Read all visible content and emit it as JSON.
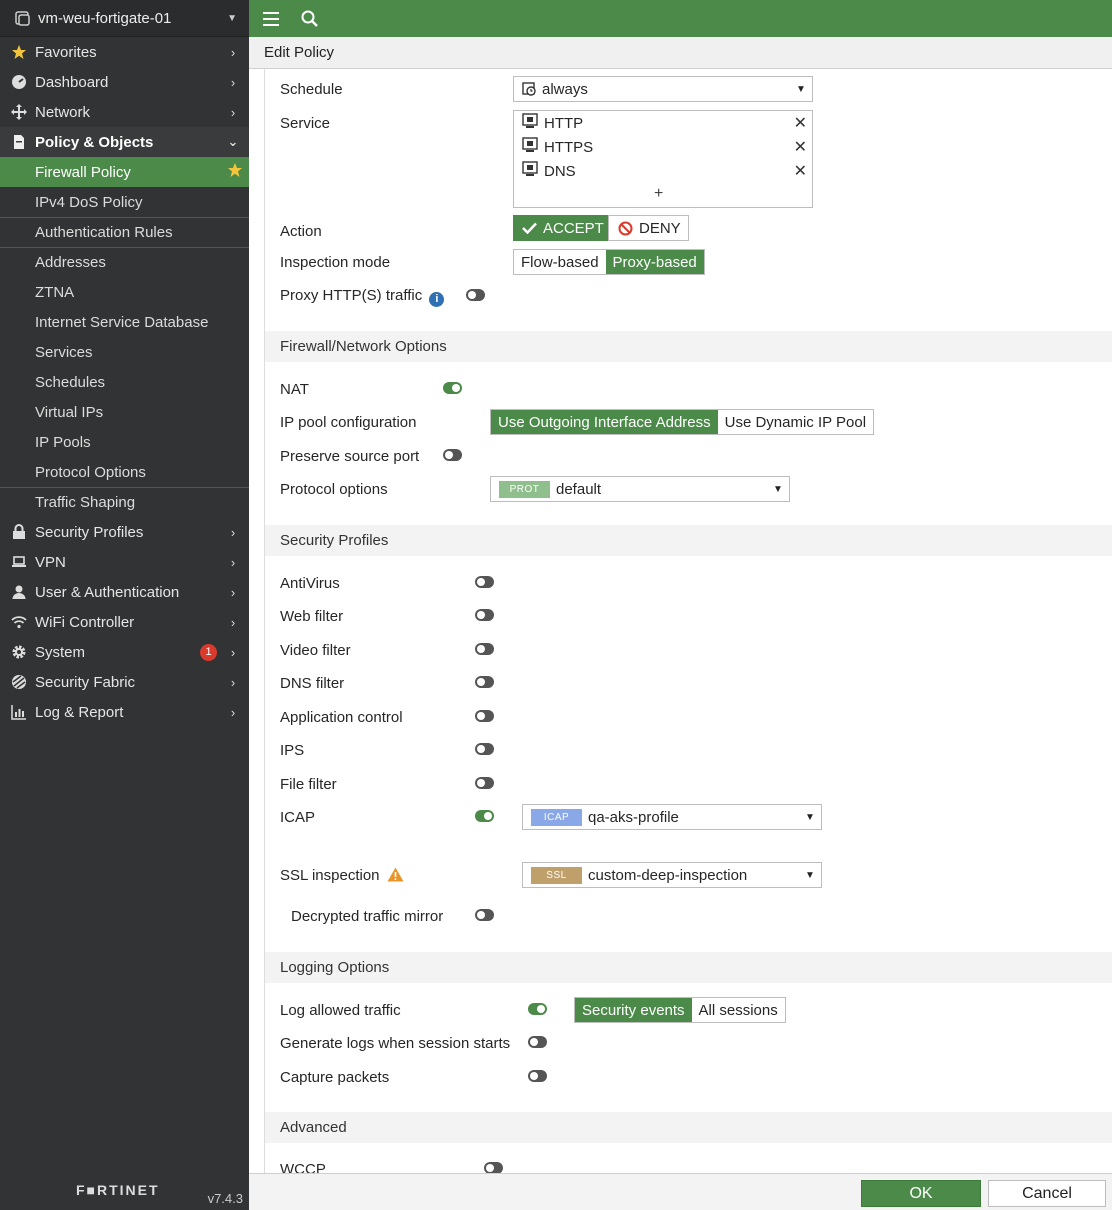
{
  "sidebar": {
    "device_name": "vm-weu-fortigate-01",
    "items": [
      {
        "label": "Favorites",
        "icon": "star-icon"
      },
      {
        "label": "Dashboard",
        "icon": "dashboard-icon"
      },
      {
        "label": "Network",
        "icon": "network-icon"
      },
      {
        "label": "Policy & Objects",
        "icon": "policy-icon"
      }
    ],
    "sub_items": [
      {
        "label": "Firewall Policy"
      },
      {
        "label": "IPv4 DoS Policy"
      },
      {
        "label": "Authentication Rules"
      },
      {
        "label": "Addresses"
      },
      {
        "label": "ZTNA"
      },
      {
        "label": "Internet Service Database"
      },
      {
        "label": "Services"
      },
      {
        "label": "Schedules"
      },
      {
        "label": "Virtual IPs"
      },
      {
        "label": "IP Pools"
      },
      {
        "label": "Protocol Options"
      },
      {
        "label": "Traffic Shaping"
      }
    ],
    "items_after": [
      {
        "label": "Security Profiles",
        "icon": "lock-icon"
      },
      {
        "label": "VPN",
        "icon": "laptop-icon"
      },
      {
        "label": "User & Authentication",
        "icon": "user-icon"
      },
      {
        "label": "WiFi Controller",
        "icon": "wifi-icon"
      },
      {
        "label": "System",
        "icon": "gear-icon",
        "badge": "1"
      },
      {
        "label": "Security Fabric",
        "icon": "fabric-icon"
      },
      {
        "label": "Log & Report",
        "icon": "chart-icon"
      }
    ],
    "brand": "F■RTINET",
    "version": "v7.4.3"
  },
  "header": {
    "title": "Edit Policy"
  },
  "form": {
    "schedule": {
      "label": "Schedule",
      "value": "always"
    },
    "service": {
      "label": "Service",
      "items": [
        "HTTP",
        "HTTPS",
        "DNS"
      ],
      "add": "+"
    },
    "action": {
      "label": "Action",
      "accept": "ACCEPT",
      "deny": "DENY"
    },
    "inspection_mode": {
      "label": "Inspection mode",
      "options": [
        "Flow-based",
        "Proxy-based"
      ],
      "selected": "Proxy-based"
    },
    "proxy_http": {
      "label": "Proxy HTTP(S) traffic",
      "enabled": false
    },
    "firewall_section": "Firewall/Network Options",
    "nat": {
      "label": "NAT",
      "enabled": true
    },
    "ip_pool": {
      "label": "IP pool configuration",
      "options": [
        "Use Outgoing Interface Address",
        "Use Dynamic IP Pool"
      ],
      "selected": "Use Outgoing Interface Address"
    },
    "preserve_port": {
      "label": "Preserve source port",
      "enabled": false
    },
    "protocol_options": {
      "label": "Protocol options",
      "tag": "PROT",
      "value": "default"
    },
    "security_section": "Security Profiles",
    "profiles": [
      {
        "label": "AntiVirus",
        "enabled": false
      },
      {
        "label": "Web filter",
        "enabled": false
      },
      {
        "label": "Video filter",
        "enabled": false
      },
      {
        "label": "DNS filter",
        "enabled": false
      },
      {
        "label": "Application control",
        "enabled": false
      },
      {
        "label": "IPS",
        "enabled": false
      },
      {
        "label": "File filter",
        "enabled": false
      },
      {
        "label": "ICAP",
        "enabled": true
      }
    ],
    "icap_profile": {
      "tag": "ICAP",
      "value": "qa-aks-profile"
    },
    "ssl": {
      "label": "SSL inspection",
      "tag": "SSL",
      "value": "custom-deep-inspection"
    },
    "decrypted_mirror": {
      "label": "Decrypted traffic mirror",
      "enabled": false
    },
    "logging_section": "Logging Options",
    "log_allowed": {
      "label": "Log allowed traffic",
      "enabled": true,
      "options": [
        "Security events",
        "All sessions"
      ],
      "selected": "Security events"
    },
    "log_session_start": {
      "label": "Generate logs when session starts",
      "enabled": false
    },
    "capture_packets": {
      "label": "Capture packets",
      "enabled": false
    },
    "advanced_section": "Advanced",
    "wccp": {
      "label": "WCCP",
      "enabled": false
    }
  },
  "footer": {
    "ok": "OK",
    "cancel": "Cancel"
  },
  "colors": {
    "accent": "#4b8a49",
    "sidebar_bg": "#323334",
    "badge": "#d93a2b",
    "prot_tag": "#8fbf8c",
    "icap_tag": "#8aa7e8",
    "ssl_tag": "#bfa06a"
  }
}
